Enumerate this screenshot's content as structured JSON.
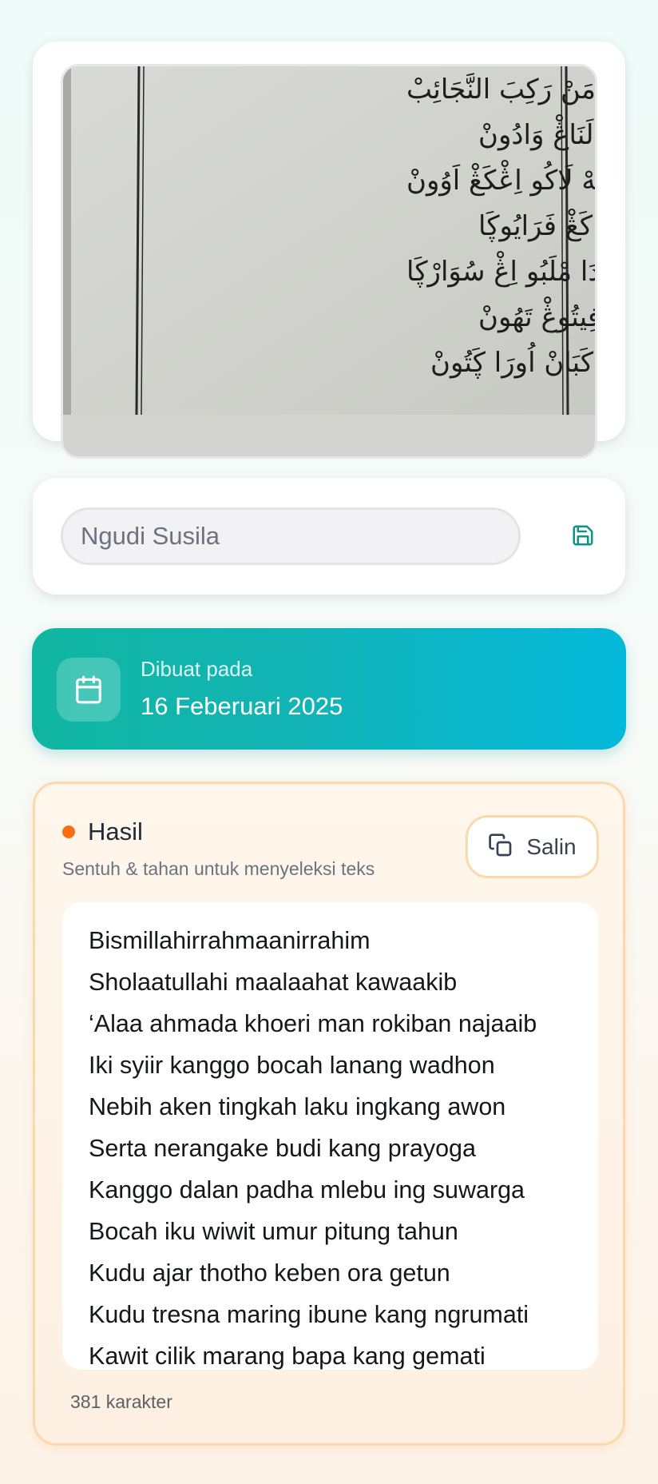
{
  "image": {
    "arabic_lines": [
      "عَلٰى اَحْمَدَ خَيْرِ مَنْ رَكِبَ النَّجَائِبْ",
      "اِيكِي شِعِرْ كَڠْڮُو بُوچَهْ لَنَاڠْ وَادُونْ",
      "نَبِيهْ اَكَي تِڠْكَهْ لَاكُو اِڠْكَڠْ اَوُونْ",
      "سَرْطَا نَرَاڠَاكَي بُودِي كَڠْ فَرَايُوڮَا",
      "كَڠْڮُو دَالَانْ فَدَا مْلَبُو اِڠْ سُوَارْڮَا",
      "بُوچَهْ اِيكُو وِيوِيتْ عُمُرْ فِيتُوڠْ تَهُونْ",
      "كُودُو اَجَارْ طُوطَا كَبَانْ اُورَا ڮَتُونْ"
    ]
  },
  "title_input": {
    "value": "Ngudi Susila"
  },
  "save": {
    "icon": "save-icon"
  },
  "created": {
    "label": "Dibuat pada",
    "date": "16 Feberuari 2025",
    "icon": "calendar-icon"
  },
  "result": {
    "title": "Hasil",
    "hint": "Sentuh & tahan untuk menyeleksi teks",
    "copy_label": "Salin",
    "copy_icon": "copy-icon",
    "lines": [
      "Bismillahirrahmaanirrahim",
      "Sholaatullahi maalaahat kawaakib",
      "‘Alaa ahmada khoeri man rokiban najaaib",
      "Iki syiir kanggo bocah lanang wadhon",
      "Nebih aken tingkah laku ingkang awon",
      "Serta nerangake budi kang prayoga",
      "Kanggo dalan padha mlebu ing suwarga",
      "Bocah iku wiwit umur pitung tahun",
      "Kudu ajar thotho keben ora getun",
      "Kudu tresna maring ibune kang ngrumati",
      "Kawit cilik marang bapa kang gemati"
    ],
    "char_count": "381 karakter"
  },
  "colors": {
    "accent_teal": "#10b6a0",
    "accent_cyan": "#04b8da",
    "result_dot": "#f86e14",
    "result_border": "#fbd9ad"
  }
}
